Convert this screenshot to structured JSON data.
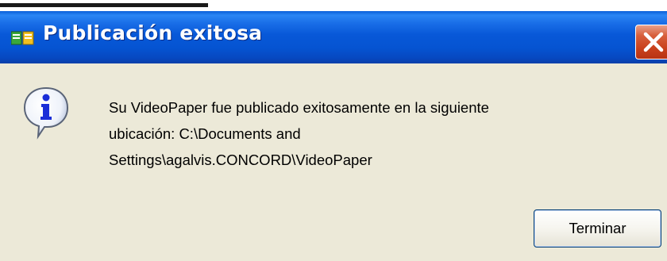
{
  "dialog": {
    "title": "Publicación exitosa",
    "message_lines": [
      "Su VideoPaper fue publicado exitosamente en la siguiente",
      "ubicación: C:\\Documents and",
      "Settings\\agalvis.CONCORD\\VideoPaper"
    ],
    "ok_button_label": "Terminar",
    "icon": "info-icon"
  },
  "colors": {
    "titlebar": "#0554d2",
    "dialog_bg": "#ece9d8",
    "close_button": "#c8401c"
  }
}
